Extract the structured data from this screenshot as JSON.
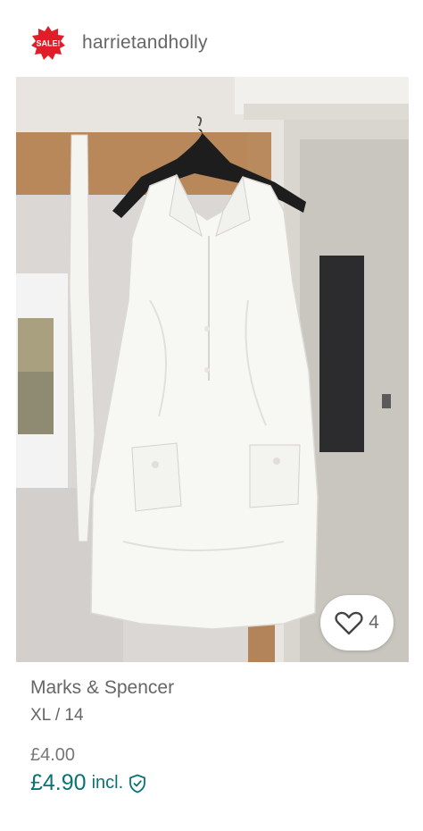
{
  "seller": {
    "badge_text": "SALE!",
    "username": "harrietandholly"
  },
  "listing": {
    "image_subject": "white sleeveless linen dress on hanger",
    "like_count": "4",
    "brand": "Marks & Spencer",
    "size": "XL / 14",
    "price": "£4.00",
    "price_incl": "£4.90",
    "incl_label": "incl."
  },
  "colors": {
    "accent": "#0a7373",
    "badge": "#e11d2a"
  },
  "icons": {
    "badge": "sale-badge-icon",
    "like": "heart-icon",
    "protection": "shield-check-icon"
  }
}
